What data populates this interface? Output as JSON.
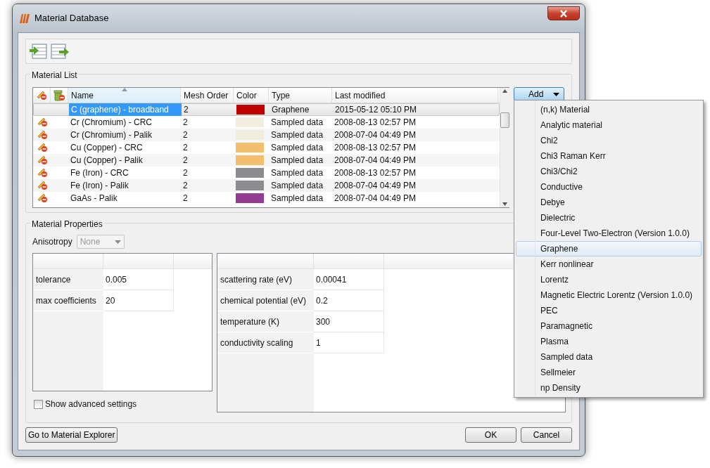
{
  "window": {
    "title": "Material Database"
  },
  "material_list": {
    "title": "Material List",
    "columns": [
      {
        "label": "Name",
        "sorted": true
      },
      {
        "label": "Mesh Order",
        "sorted": false
      },
      {
        "label": "Color",
        "sorted": false
      },
      {
        "label": "Type",
        "sorted": false
      },
      {
        "label": "Last modified",
        "sorted": false
      }
    ],
    "rows": [
      {
        "name": "C (graphene) - broadband",
        "mesh_order": "2",
        "color": "#c00000",
        "type": "Graphene",
        "last_modified": "2015-05-12 05:10 PM",
        "selected": true,
        "edit_icon": false
      },
      {
        "name": "Cr (Chromium) - CRC",
        "mesh_order": "2",
        "color": "#f2eedf",
        "type": "Sampled data",
        "last_modified": "2008-08-13 02:57 PM",
        "selected": false,
        "edit_icon": true
      },
      {
        "name": "Cr (Chromium) - Palik",
        "mesh_order": "2",
        "color": "#f2eedf",
        "type": "Sampled data",
        "last_modified": "2008-07-04 04:49 PM",
        "selected": false,
        "edit_icon": true
      },
      {
        "name": "Cu (Copper) - CRC",
        "mesh_order": "2",
        "color": "#f2bf6f",
        "type": "Sampled data",
        "last_modified": "2008-08-13 02:57 PM",
        "selected": false,
        "edit_icon": true
      },
      {
        "name": "Cu (Copper) - Palik",
        "mesh_order": "2",
        "color": "#f2bf6f",
        "type": "Sampled data",
        "last_modified": "2008-07-04 04:49 PM",
        "selected": false,
        "edit_icon": true
      },
      {
        "name": "Fe (Iron) - CRC",
        "mesh_order": "2",
        "color": "#8c8c90",
        "type": "Sampled data",
        "last_modified": "2008-08-13 02:57 PM",
        "selected": false,
        "edit_icon": true
      },
      {
        "name": "Fe (Iron) - Palik",
        "mesh_order": "2",
        "color": "#8c8c90",
        "type": "Sampled data",
        "last_modified": "2008-07-04 04:49 PM",
        "selected": false,
        "edit_icon": true
      },
      {
        "name": "GaAs - Palik",
        "mesh_order": "2",
        "color": "#933a92",
        "type": "Sampled data",
        "last_modified": "2008-07-04 04:49 PM",
        "selected": false,
        "edit_icon": true
      }
    ],
    "add_button": "Add"
  },
  "material_properties": {
    "title": "Material Properties",
    "anisotropy": {
      "label": "Anisotropy",
      "value": "None",
      "disabled": true
    },
    "left_table": [
      {
        "label": "tolerance",
        "value": "0.005"
      },
      {
        "label": "max coefficients",
        "value": "20"
      }
    ],
    "right_table": [
      {
        "label": "scattering rate (eV)",
        "value": "0.00041"
      },
      {
        "label": "chemical potential (eV)",
        "value": "0.2"
      },
      {
        "label": "temperature (K)",
        "value": "300"
      },
      {
        "label": "conductivity scaling",
        "value": "1"
      }
    ],
    "show_advanced": {
      "label": "Show advanced settings",
      "checked": false
    }
  },
  "buttons": {
    "explorer": "Go to Material Explorer",
    "ok": "OK",
    "cancel": "Cancel"
  },
  "add_menu": [
    {
      "label": "(n,k) Material",
      "selected": false
    },
    {
      "label": "Analytic material",
      "selected": false
    },
    {
      "label": "Chi2",
      "selected": false
    },
    {
      "label": "Chi3 Raman Kerr",
      "selected": false
    },
    {
      "label": "Chi3/Chi2",
      "selected": false
    },
    {
      "label": "Conductive",
      "selected": false
    },
    {
      "label": "Debye",
      "selected": false
    },
    {
      "label": "Dielectric",
      "selected": false
    },
    {
      "label": "Four-Level Two-Electron (Version 1.0.0)",
      "selected": false
    },
    {
      "label": "Graphene",
      "selected": true
    },
    {
      "label": "Kerr nonlinear",
      "selected": false
    },
    {
      "label": "Lorentz",
      "selected": false
    },
    {
      "label": "Magnetic Electric Lorentz (Version 1.0.0)",
      "selected": false
    },
    {
      "label": "PEC",
      "selected": false
    },
    {
      "label": "Paramagnetic",
      "selected": false
    },
    {
      "label": "Plasma",
      "selected": false
    },
    {
      "label": "Sampled data",
      "selected": false
    },
    {
      "label": "Sellmeier",
      "selected": false
    },
    {
      "label": "np Density",
      "selected": false
    }
  ]
}
